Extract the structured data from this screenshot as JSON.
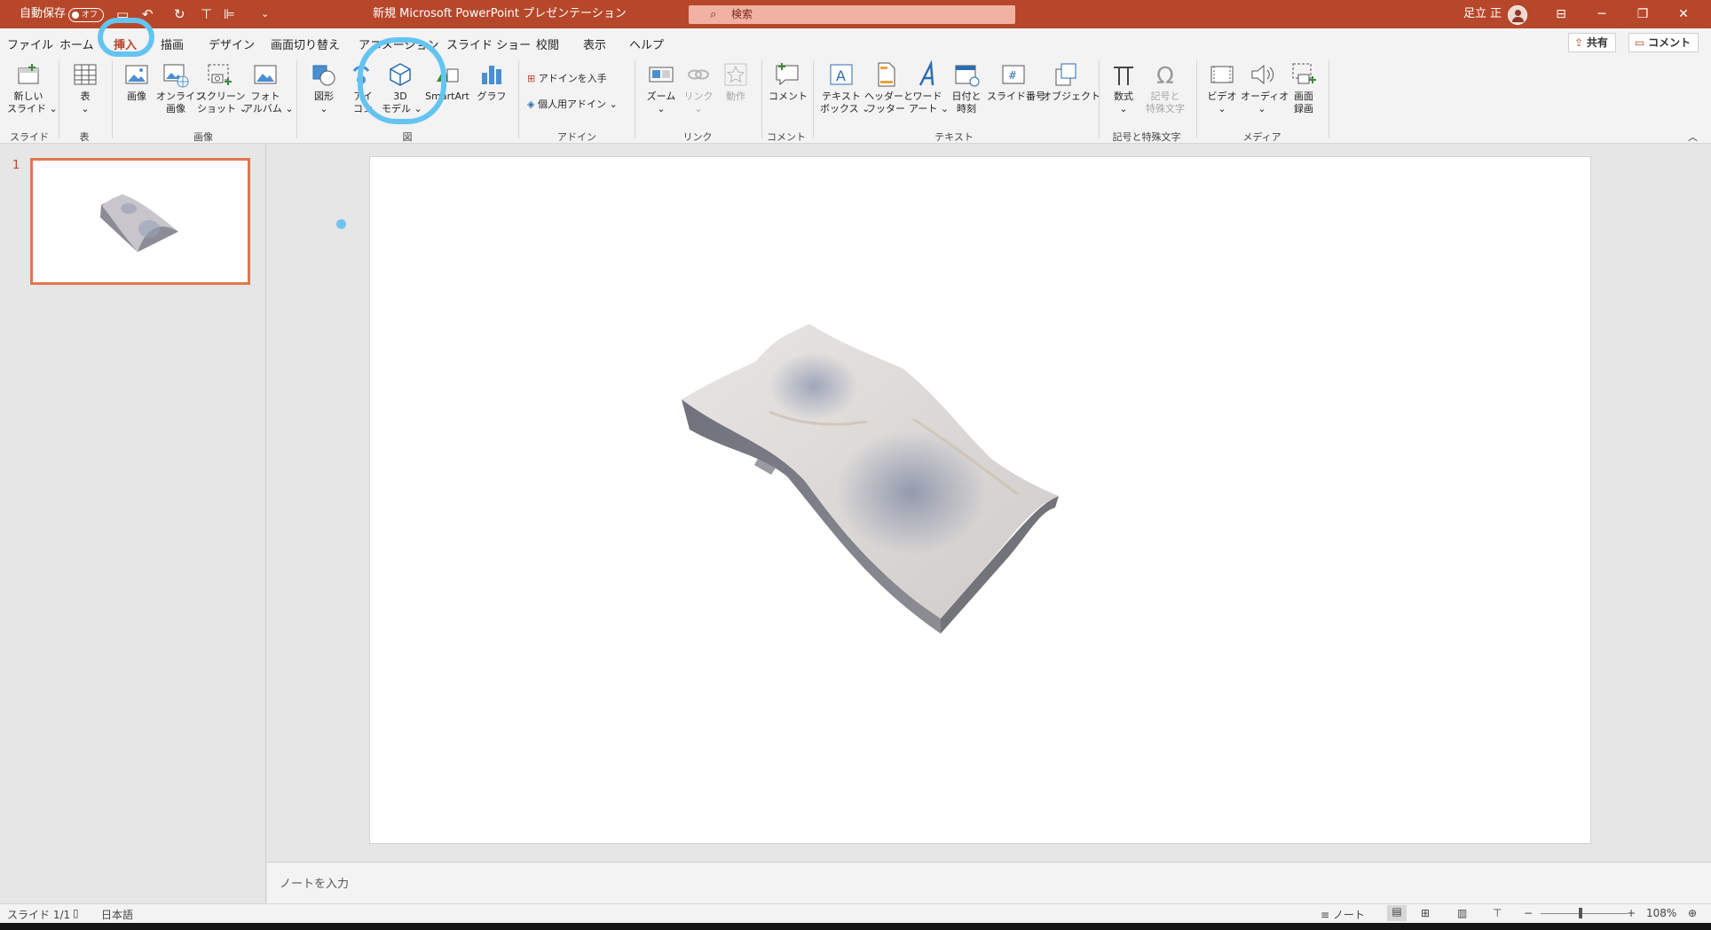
{
  "titlebar": {
    "autosave_label": "自動保存",
    "autosave_state": "オフ",
    "doc_title": "新規 Microsoft PowerPoint プレゼンテーション",
    "search_placeholder": "検索",
    "user_name": "足立 正"
  },
  "tabs": [
    "ファイル",
    "ホーム",
    "挿入",
    "描画",
    "デザイン",
    "画面切り替え",
    "アニメーション",
    "スライド ショー",
    "校閲",
    "表示",
    "ヘルプ"
  ],
  "active_tab": "挿入",
  "share_label": "共有",
  "comment_button_label": "コメント",
  "ribbon": {
    "new_slide": [
      "新しい",
      "スライド ⌄"
    ],
    "table": [
      "表",
      "⌄"
    ],
    "picture": "画像",
    "online_picture": [
      "オンライン",
      "画像"
    ],
    "screenshot": [
      "スクリーン",
      "ショット ⌄"
    ],
    "photo_album": [
      "フォト",
      "アルバム ⌄"
    ],
    "shapes": [
      "図形",
      "⌄"
    ],
    "icons": [
      "アイ",
      "コン"
    ],
    "model3d": [
      "3D",
      "モデル ⌄"
    ],
    "smartart": "SmartArt",
    "chart": "グラフ",
    "get_addins": "アドインを入手",
    "my_addins": "個人用アドイン",
    "zoom": [
      "ズーム",
      "⌄"
    ],
    "link": [
      "リンク",
      "⌄"
    ],
    "action": "動作",
    "comment": "コメント",
    "textbox": [
      "テキスト",
      "ボックス ⌄"
    ],
    "header_footer": [
      "ヘッダーと",
      "フッター"
    ],
    "wordart": [
      "ワード",
      "アート ⌄"
    ],
    "datetime": [
      "日付と",
      "時刻"
    ],
    "slide_number": "スライド番号",
    "object": "オブジェクト",
    "equation": [
      "数式",
      "⌄"
    ],
    "symbol": [
      "記号と",
      "特殊文字"
    ],
    "video": [
      "ビデオ",
      "⌄"
    ],
    "audio": [
      "オーディオ",
      "⌄"
    ],
    "screen_recording": [
      "画面",
      "録画"
    ],
    "groups": {
      "slides": "スライド",
      "tables": "表",
      "images": "画像",
      "illustrations": "図",
      "addins": "アドイン",
      "links": "リンク",
      "comments": "コメント",
      "text": "テキスト",
      "symbols": "記号と特殊文字",
      "media": "メディア"
    }
  },
  "thumbnail": {
    "number": "1"
  },
  "notes_placeholder": "ノートを入力",
  "status": {
    "slide_count": "スライド 1/1",
    "language": "日本語",
    "notes": "ノート",
    "zoom_minus": "−",
    "zoom_plus": "+",
    "zoom_level": "108%"
  },
  "colors": {
    "accent": "#b7472a",
    "highlight": "#64c4f1"
  }
}
